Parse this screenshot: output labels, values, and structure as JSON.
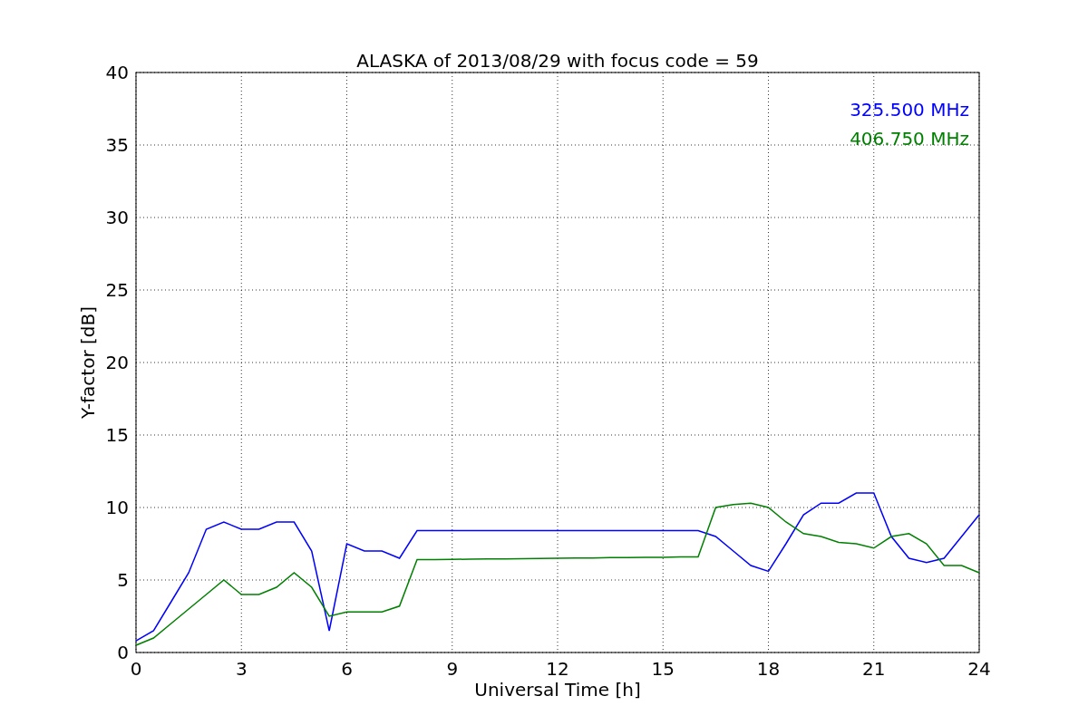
{
  "figure": {
    "chart_data": {
      "type": "line",
      "title": "ALASKA of 2013/08/29 with focus code = 59",
      "xlabel": "Universal Time [h]",
      "ylabel": "Y-factor [dB]",
      "x": [
        0,
        0.5,
        1,
        1.5,
        2,
        2.5,
        3,
        3.5,
        4,
        4.5,
        5,
        5.5,
        6,
        6.5,
        7,
        7.5,
        8,
        8.5,
        9,
        9.5,
        10,
        10.5,
        11,
        11.5,
        12,
        12.5,
        13,
        13.5,
        14,
        14.5,
        15,
        15.5,
        16,
        16.5,
        17,
        17.5,
        18,
        18.5,
        19,
        19.5,
        20,
        20.5,
        21,
        21.5,
        22,
        22.5,
        23,
        23.5,
        24
      ],
      "series": [
        {
          "name": "325.500 MHz",
          "color": "#0000ff",
          "values": [
            0.8,
            1.5,
            3.5,
            5.5,
            8.5,
            9,
            8.5,
            8.5,
            9,
            9,
            7,
            1.5,
            7.5,
            7,
            7,
            6.5,
            8.4,
            8.4,
            8.4,
            8.4,
            8.4,
            8.4,
            8.4,
            8.4,
            8.4,
            8.4,
            8.4,
            8.4,
            8.4,
            8.4,
            8.4,
            8.4,
            8.4,
            8,
            7,
            6,
            5.6,
            7.5,
            9.5,
            10.3,
            10.3,
            11,
            11,
            8,
            6.5,
            6.2,
            6.5,
            8,
            9.5
          ]
        },
        {
          "name": "406.750 MHz",
          "color": "#008000",
          "values": [
            0.5,
            1,
            2,
            3,
            4,
            5,
            4,
            4,
            4.5,
            5.5,
            4.5,
            2.5,
            2.8,
            2.8,
            2.8,
            3.2,
            6.4,
            6.41,
            6.42,
            6.44,
            6.45,
            6.46,
            6.47,
            6.49,
            6.5,
            6.51,
            6.52,
            6.54,
            6.55,
            6.56,
            6.57,
            6.59,
            6.6,
            10,
            10.2,
            10.3,
            10,
            9,
            8.2,
            8,
            7.6,
            7.5,
            7.2,
            8,
            8.2,
            7.5,
            6,
            6,
            5.5
          ]
        }
      ],
      "grid": true,
      "xlim": [
        0,
        24
      ],
      "ylim": [
        0,
        40
      ],
      "xticks": [
        0,
        3,
        6,
        9,
        12,
        15,
        18,
        21,
        24
      ],
      "yticks": [
        0,
        5,
        10,
        15,
        20,
        25,
        30,
        35,
        40
      ]
    }
  }
}
